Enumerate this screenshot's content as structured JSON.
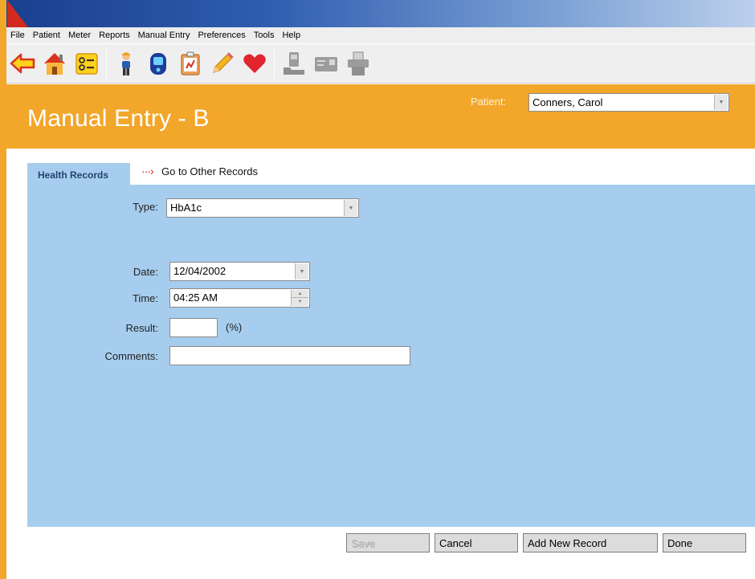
{
  "menu": [
    "File",
    "Patient",
    "Meter",
    "Reports",
    "Manual Entry",
    "Preferences",
    "Tools",
    "Help"
  ],
  "toolbar": {
    "icons": [
      "back-arrow-icon",
      "home-icon",
      "checklist-icon",
      "person-icon",
      "meter-device-icon",
      "logbook-icon",
      "pencil-icon",
      "heart-icon",
      "meter-upload-icon",
      "card-reader-icon",
      "printer-icon"
    ]
  },
  "header": {
    "title": "Manual Entry - B",
    "patient_label": "Patient:",
    "patient_value": "Conners, Carol"
  },
  "tabs": {
    "active": "Health Records",
    "other_link": "Go to Other Records"
  },
  "form": {
    "type_label": "Type:",
    "type_value": "HbA1c",
    "date_label": "Date:",
    "date_value": "12/04/2002",
    "time_label": "Time:",
    "time_value": "04:25 AM",
    "result_label": "Result:",
    "result_value": "",
    "result_unit": "(%)",
    "comments_label": "Comments:",
    "comments_value": ""
  },
  "buttons": {
    "save": "Save",
    "cancel": "Cancel",
    "add_new": "Add New Record",
    "done": "Done"
  },
  "colors": {
    "header_orange": "#f2a62a",
    "panel_blue": "#a6cdee",
    "tab_text": "#23446f",
    "accent_red": "#d12a1e"
  }
}
